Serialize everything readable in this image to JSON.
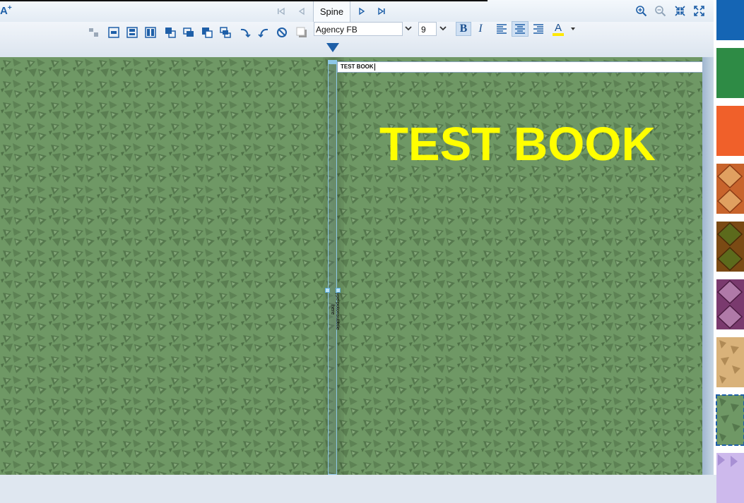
{
  "topbar": {
    "add_text_label": "A",
    "add_text_sup": "+",
    "spine_label": "Spine"
  },
  "toolbar": {
    "font_family": "Agency FB",
    "font_size": "9",
    "bold_label": "B",
    "italic_label": "I",
    "font_color_label": "A",
    "font_color_underline": "#ffe800"
  },
  "cover": {
    "title_input_value": "TEST BOOK",
    "title_text": "TEST BOOK",
    "title_color": "#ffff00",
    "background_color": "#6f9865",
    "spine_text": "Type potonsubtitle here"
  },
  "swatches": [
    {
      "name": "blue",
      "color": "#1565b4"
    },
    {
      "name": "green",
      "color": "#2e8b45"
    },
    {
      "name": "orange",
      "color": "#f0602a"
    },
    {
      "name": "orange-diamond",
      "color": "#c8642c"
    },
    {
      "name": "brown-diamond",
      "color": "#7a4a14"
    },
    {
      "name": "purple-diamond",
      "color": "#7a3a6e"
    },
    {
      "name": "tan-triangle",
      "color": "#d9b27a"
    },
    {
      "name": "green-triangle",
      "color": "#6f9865",
      "selected": true
    },
    {
      "name": "lavender-pattern",
      "color": "#cdb9ec"
    }
  ]
}
